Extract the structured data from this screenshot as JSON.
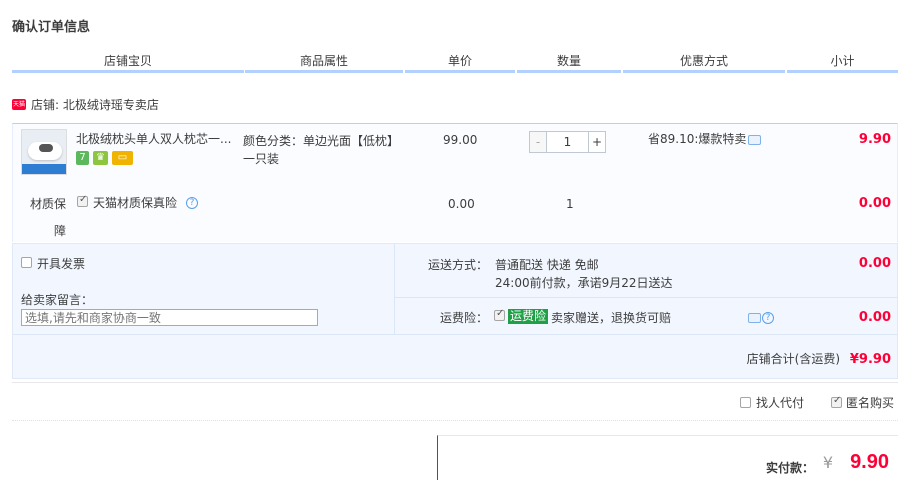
{
  "page_title": "确认订单信息",
  "columns": [
    "店铺宝贝",
    "商品属性",
    "单价",
    "数量",
    "优惠方式",
    "小计"
  ],
  "shop": {
    "badge": "天猫",
    "label": "店铺: 北极绒诗瑶专卖店"
  },
  "item": {
    "title": "北极绒枕头单人双人枕芯一...",
    "badges": [
      {
        "text": "7",
        "color": "#5cb85c"
      },
      {
        "text": "♛",
        "color": "#8cc63f"
      },
      {
        "text": "▭",
        "color": "#f0b400"
      }
    ],
    "sku_line1": "颜色分类：单边光面【低枕】",
    "sku_line2": "一只装",
    "price": "99.00",
    "quantity": "1",
    "qty_minus": "-",
    "qty_plus": "+",
    "promo": "省89.10:爆款特卖",
    "subtotal": "9.90"
  },
  "insurance": {
    "label_line1": "材质保",
    "label_line2": "障",
    "option": "天猫材质保真险",
    "help": "?",
    "price": "0.00",
    "quantity": "1",
    "subtotal": "0.00"
  },
  "invoice": {
    "label": "开具发票"
  },
  "message": {
    "label": "给卖家留言：",
    "placeholder": "选填,请先和商家协商一致"
  },
  "shipping": {
    "label": "运送方式：",
    "method": "普通配送 快递 免邮",
    "promise": "24:00前付款，承诺9月22日送达",
    "fee": "0.00"
  },
  "freight_insurance": {
    "label": "运费险：",
    "tag": "运费险",
    "desc": "卖家赠送，退换货可赔",
    "help": "?",
    "fee": "0.00"
  },
  "shop_total": {
    "label": "店铺合计(含运费)",
    "amount": "¥9.90"
  },
  "options": {
    "proxy_pay": "找人代付",
    "anonymous": "匿名购买"
  },
  "payment": {
    "label": "实付款：",
    "currency": "¥",
    "amount": "9.90"
  },
  "colors": {
    "accent_red": "#ff0036",
    "accent_blue": "#b2d1ff",
    "panel_bg": "#f2f7ff"
  }
}
